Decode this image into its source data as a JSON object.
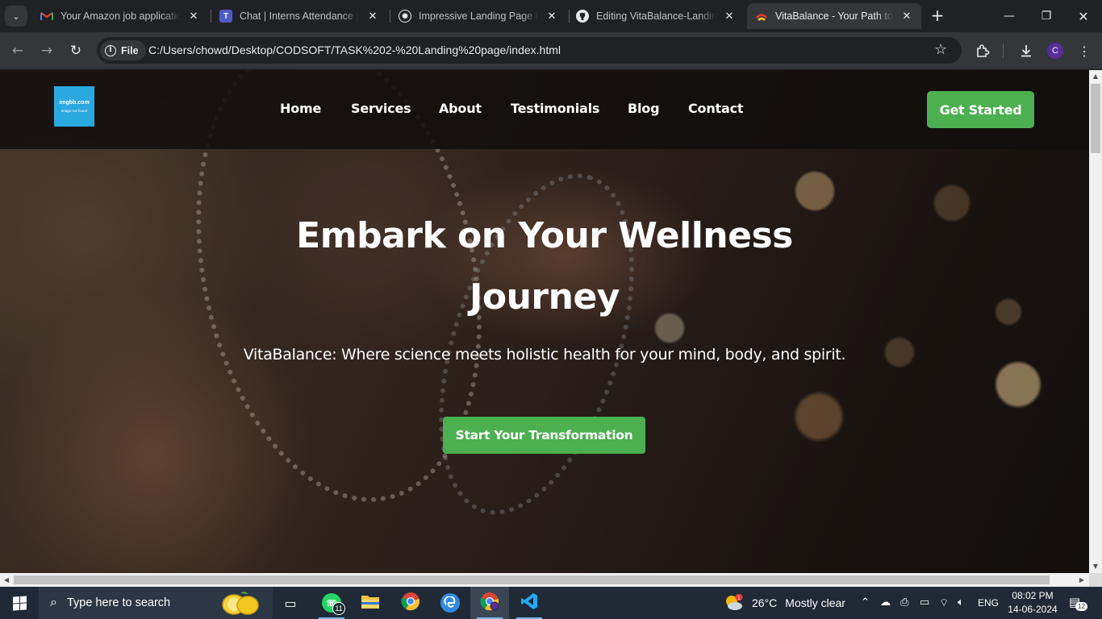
{
  "browser": {
    "tabs": [
      {
        "title": "Your Amazon job application",
        "icon": "gmail-icon",
        "color": "#ea4335"
      },
      {
        "title": "Chat | Interns Attendance | M",
        "icon": "teams-icon",
        "color": "#5059c9"
      },
      {
        "title": "Impressive Landing Page Pro",
        "icon": "chatgpt-icon",
        "color": "#ffffff"
      },
      {
        "title": "Editing VitaBalance-Landing",
        "icon": "github-icon",
        "color": "#ffffff"
      },
      {
        "title": "VitaBalance - Your Path to H",
        "icon": "vitabalance-icon",
        "color": "#e53935"
      }
    ],
    "active_tab_index": 4,
    "address": {
      "scheme_label": "File",
      "url": "C:/Users/chowd/Desktop/CODSOFT/TASK%202-%20Landing%20page/index.html"
    },
    "profile_initial": "C",
    "profile_color": "#5b2d9a"
  },
  "site": {
    "logo": {
      "line1": "imgbb.com",
      "line2": "image not found",
      "bg": "#2aa8e0"
    },
    "nav": [
      "Home",
      "Services",
      "About",
      "Testimonials",
      "Blog",
      "Contact"
    ],
    "header_cta": "Get Started",
    "hero": {
      "title": "Embark on Your Wellness Journey",
      "subtitle": "VitaBalance: Where science meets holistic health for your mind, body, and spirit.",
      "cta": "Start Your Transformation"
    },
    "accent": "#4caf50"
  },
  "taskbar": {
    "search_placeholder": "Type here to search",
    "apps": [
      {
        "name": "task-view-icon"
      },
      {
        "name": "whatsapp-icon",
        "badge": "11"
      },
      {
        "name": "file-explorer-icon"
      },
      {
        "name": "chrome-icon"
      },
      {
        "name": "edge-icon"
      },
      {
        "name": "chrome-profile-icon"
      },
      {
        "name": "vscode-icon"
      }
    ],
    "weather": {
      "temp": "26°C",
      "condition": "Mostly clear",
      "badge": "1"
    },
    "language": "ENG",
    "time": "08:02 PM",
    "date": "14-06-2024",
    "notifications": "12"
  }
}
